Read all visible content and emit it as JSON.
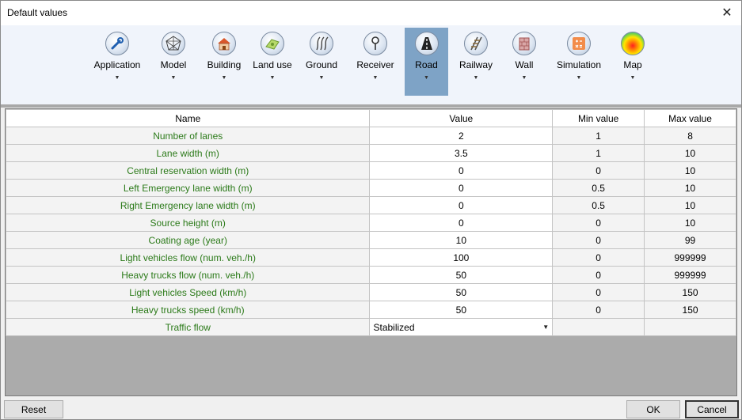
{
  "window": {
    "title": "Default values",
    "close_glyph": "✕"
  },
  "ribbon": {
    "items": [
      {
        "label": "Application",
        "icon": "wrench-icon",
        "active": false
      },
      {
        "label": "Model",
        "icon": "mesh-icon",
        "active": false
      },
      {
        "label": "Building",
        "icon": "house-icon",
        "active": false
      },
      {
        "label": "Land use",
        "icon": "land-use-icon",
        "active": false
      },
      {
        "label": "Ground",
        "icon": "ground-icon",
        "active": false
      },
      {
        "label": "Receiver",
        "icon": "receiver-icon",
        "active": false
      },
      {
        "label": "Road",
        "icon": "road-icon",
        "active": true
      },
      {
        "label": "Railway",
        "icon": "railway-icon",
        "active": false
      },
      {
        "label": "Wall",
        "icon": "wall-icon",
        "active": false
      },
      {
        "label": "Simulation",
        "icon": "calculator-icon",
        "active": false
      },
      {
        "label": "Map",
        "icon": "heatmap-icon",
        "active": false
      }
    ],
    "arrow_glyph": "▼",
    "accent_color": "#7ea3c6"
  },
  "grid": {
    "headers": {
      "name": "Name",
      "value": "Value",
      "min": "Min value",
      "max": "Max value"
    },
    "rows": [
      {
        "name": "Number of lanes",
        "value": "2",
        "min": "1",
        "max": "8"
      },
      {
        "name": "Lane width (m)",
        "value": "3.5",
        "min": "1",
        "max": "10"
      },
      {
        "name": "Central reservation width (m)",
        "value": "0",
        "min": "0",
        "max": "10"
      },
      {
        "name": "Left Emergency lane width (m)",
        "value": "0",
        "min": "0.5",
        "max": "10"
      },
      {
        "name": "Right Emergency lane width (m)",
        "value": "0",
        "min": "0.5",
        "max": "10"
      },
      {
        "name": "Source height (m)",
        "value": "0",
        "min": "0",
        "max": "10"
      },
      {
        "name": "Coating age (year)",
        "value": "10",
        "min": "0",
        "max": "99"
      },
      {
        "name": "Light vehicles flow (num. veh./h)",
        "value": "100",
        "min": "0",
        "max": "999999"
      },
      {
        "name": "Heavy trucks flow (num. veh./h)",
        "value": "50",
        "min": "0",
        "max": "999999"
      },
      {
        "name": "Light vehicles Speed (km/h)",
        "value": "50",
        "min": "0",
        "max": "150"
      },
      {
        "name": "Heavy trucks speed (km/h)",
        "value": "50",
        "min": "0",
        "max": "150"
      }
    ],
    "traffic_flow": {
      "name": "Traffic flow",
      "value": "Stabilized",
      "min": "",
      "max": ""
    },
    "name_color": "#2b7a19"
  },
  "buttons": {
    "reset": "Reset",
    "ok": "OK",
    "cancel": "Cancel"
  }
}
